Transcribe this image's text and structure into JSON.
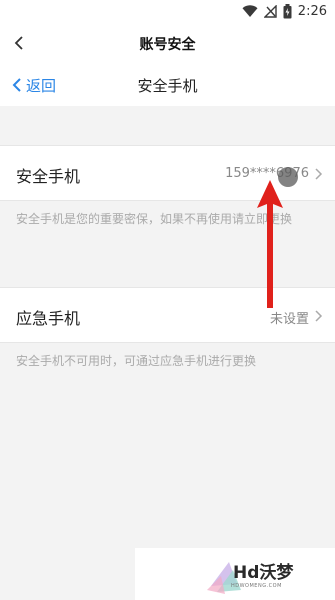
{
  "status_bar": {
    "time": "2:26"
  },
  "outer_header": {
    "title": "账号安全"
  },
  "inner_header": {
    "back_label": "返回",
    "title": "安全手机"
  },
  "security_phone": {
    "label": "安全手机",
    "value": "159****6976",
    "hint": "安全手机是您的重要密保，如果不再使用请立即更换"
  },
  "emergency_phone": {
    "label": "应急手机",
    "value": "未设置",
    "hint": "安全手机不可用时，可通过应急手机进行更换"
  },
  "watermark": {
    "text": "Hd沃梦",
    "subtext": "HDWOMENG.COM"
  },
  "colors": {
    "accent": "#2b86e6",
    "annotation": "#e0211b"
  }
}
